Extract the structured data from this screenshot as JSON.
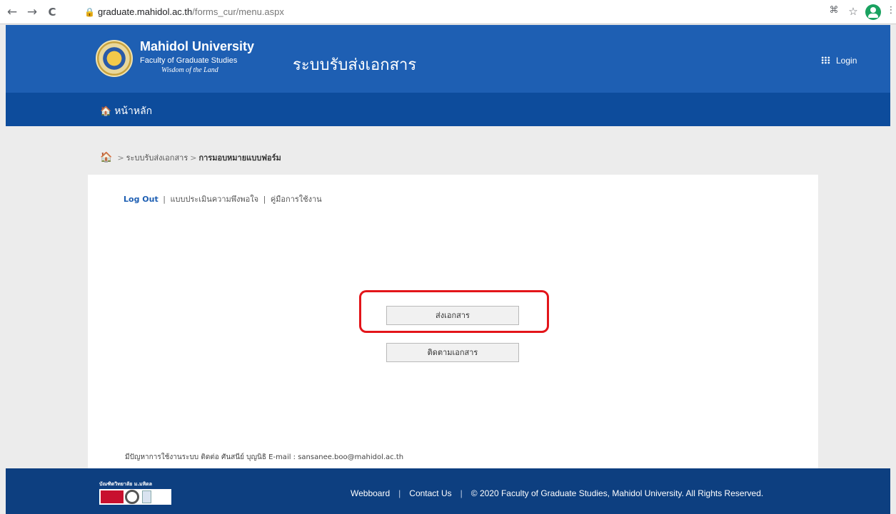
{
  "browser": {
    "nav": {
      "back": "←",
      "forward": "→",
      "reload": "C"
    },
    "url_host": "graduate.mahidol.ac.th",
    "url_path": "/forms_cur/menu.aspx"
  },
  "header": {
    "university": "Mahidol University",
    "faculty": "Faculty of Graduate Studies",
    "motto": "Wisdom of the Land",
    "system_title": "ระบบรับส่งเอกสาร",
    "login_label": "Login"
  },
  "navbar": {
    "home_label": "หน้าหลัก"
  },
  "breadcrumb": {
    "separator": ">",
    "items": [
      "ระบบรับส่งเอกสาร",
      "การมอบหมายแบบฟอร์ม"
    ]
  },
  "content": {
    "links": {
      "logout": "Log Out",
      "separator": "|",
      "survey": "แบบประเมินความพึงพอใจ",
      "manual": "คู่มือการใช้งาน"
    },
    "buttons": {
      "send": "ส่งเอกสาร",
      "track": "ติดตามเอกสาร"
    },
    "contact": "มีปัญหาการใช้งานระบบ ติดต่อ ศันสนีย์ บุญนิธิ E-mail : sansanee.boo@mahidol.ac.th"
  },
  "footer": {
    "logo_caption": "บัณฑิตวิทยาลัย ม.มหิดล",
    "separator": "|",
    "webboard": "Webboard",
    "contact_us": "Contact Us",
    "copyright": "© 2020 Faculty of Graduate Studies, Mahidol University. All Rights Reserved."
  },
  "colors": {
    "header": "#1e5fb3",
    "navbar": "#0d4c9c",
    "footer": "#0d3f80",
    "highlight": "#e3151a"
  }
}
